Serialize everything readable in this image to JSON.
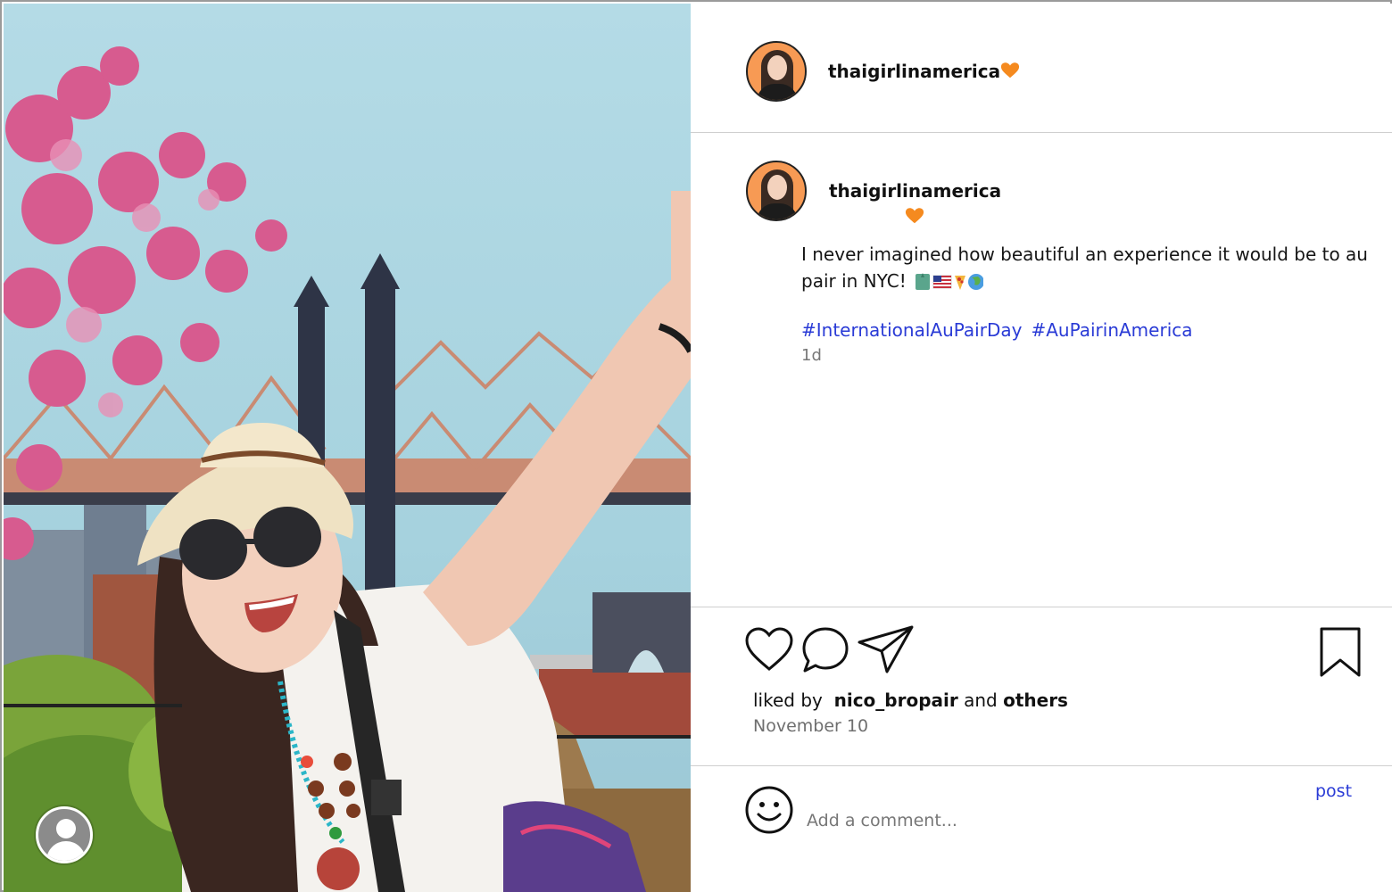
{
  "post": {
    "header_username": "thaigirlinamerica",
    "caption_username": "thaigirlinamerica",
    "caption_text": "I never imagined how beautiful an experience it would be to au pair in NYC!",
    "caption_emojis": [
      "statue-of-liberty",
      "us-flag",
      "pizza",
      "globe"
    ],
    "hashtags": [
      "#InternationalAuPairDay",
      "#AuPairinAmerica"
    ],
    "relative_time": "1d",
    "badge_icon": "orange-heart-icon",
    "accent_color": "#f58a1f",
    "link_color": "#2a3bd6"
  },
  "engagement": {
    "liked_by_prefix": "liked by",
    "liked_by_user": "nico_bropair",
    "liked_by_joiner": "and",
    "liked_by_others": "others",
    "date": "November 10"
  },
  "actions": {
    "icons": [
      "heart-icon",
      "comment-icon",
      "share-icon",
      "bookmark-icon"
    ]
  },
  "comment": {
    "placeholder": "Add a comment...",
    "post_label": "post",
    "emoji_icon": "smiley-icon"
  }
}
